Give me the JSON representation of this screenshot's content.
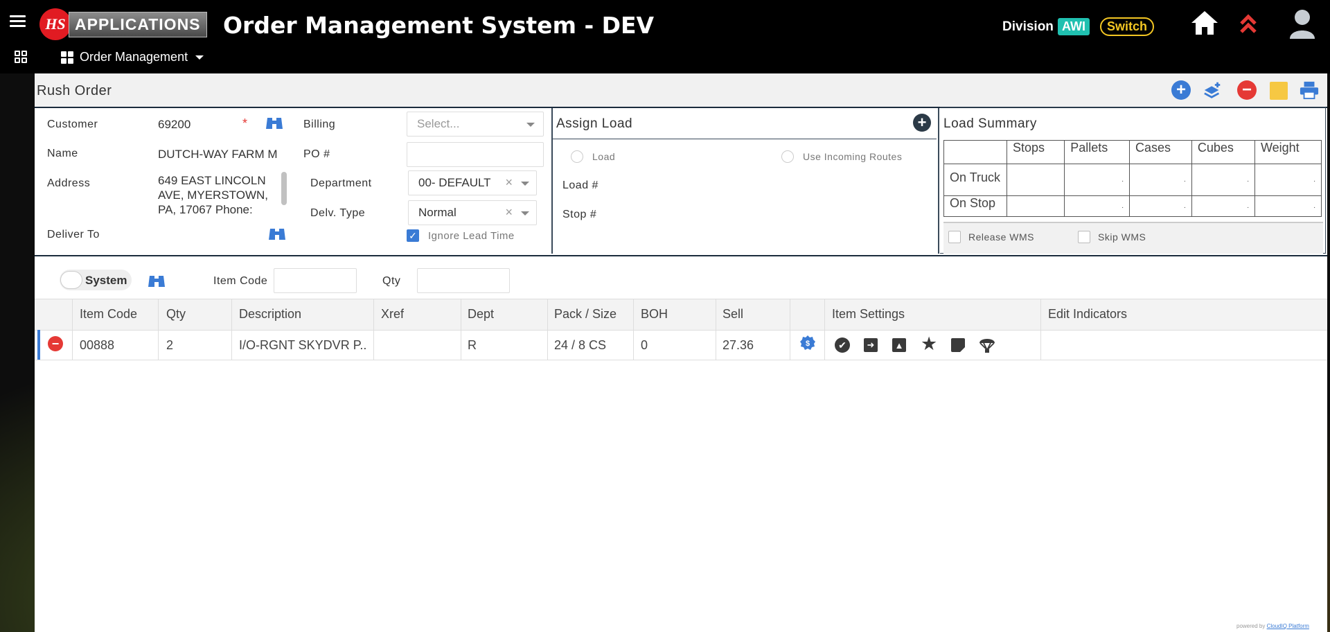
{
  "header": {
    "logo_mark": "HS",
    "logo_text": "APPLICATIONS",
    "title": "Order Management System - DEV",
    "division_label": "Division",
    "division_value": "AWI",
    "switch_label": "Switch",
    "menu_label": "Order Management"
  },
  "panel": {
    "title": "Rush Order",
    "toolbar": [
      "add-icon",
      "add-layer-icon",
      "remove-icon",
      "note-icon",
      "print-icon"
    ]
  },
  "customer_form": {
    "customer_label": "Customer",
    "customer_value": "69200",
    "required_mark": "*",
    "name_label": "Name",
    "name_value": "DUTCH-WAY FARM M",
    "address_label": "Address",
    "address_value": "649 EAST LINCOLN AVE, MYERSTOWN, PA, 17067 Phone:",
    "deliver_to_label": "Deliver To",
    "billing_label": "Billing",
    "billing_placeholder": "Select...",
    "po_label": "PO #",
    "po_value": "",
    "department_label": "Department",
    "department_value": "00- DEFAULT",
    "delv_type_label": "Delv. Type",
    "delv_type_value": "Normal",
    "ignore_lead_time_label": "Ignore Lead Time",
    "clear_mark": "×",
    "check_mark": "✓"
  },
  "assign_load": {
    "title": "Assign Load",
    "load_radio_label": "Load",
    "incoming_routes_label": "Use Incoming Routes",
    "load_num_label": "Load #",
    "stop_num_label": "Stop #"
  },
  "load_summary": {
    "title": "Load Summary",
    "columns": [
      "Stops",
      "Pallets",
      "Cases",
      "Cubes",
      "Weight"
    ],
    "rows": [
      {
        "label": "On Truck",
        "values": [
          "",
          ".",
          ".",
          ".",
          "."
        ]
      },
      {
        "label": "On Stop",
        "values": [
          "",
          ".",
          ".",
          ".",
          "."
        ]
      }
    ],
    "release_wms_label": "Release WMS",
    "skip_wms_label": "Skip WMS"
  },
  "item_entry": {
    "system_toggle_label": "System",
    "item_code_label": "Item Code",
    "qty_label": "Qty"
  },
  "grid": {
    "columns": [
      "Item Code",
      "Qty",
      "Description",
      "Xref",
      "Dept",
      "Pack / Size",
      "BOH",
      "Sell",
      "Item Settings",
      "Edit Indicators"
    ],
    "rows": [
      {
        "item_code": "00888",
        "qty": "2",
        "description": "I/O-RGNT SKYDVR P...",
        "xref": "",
        "dept": "R",
        "pack_size": "24 / 8 CS",
        "boh": "0",
        "sell": "27.36"
      }
    ],
    "settings_icons": [
      "check-circle-icon",
      "arrow-right-icon",
      "arrow-up-icon",
      "star-icon",
      "note-icon",
      "parachute-icon"
    ]
  },
  "footer": {
    "powered_by": "powered by",
    "platform": "CloudIQ Platform"
  },
  "colors": {
    "accent_blue": "#3a7bd5",
    "danger_red": "#e53935",
    "teal_badge": "#20c0b0",
    "switch_yellow": "#f3c623",
    "note_yellow": "#f6c843"
  }
}
